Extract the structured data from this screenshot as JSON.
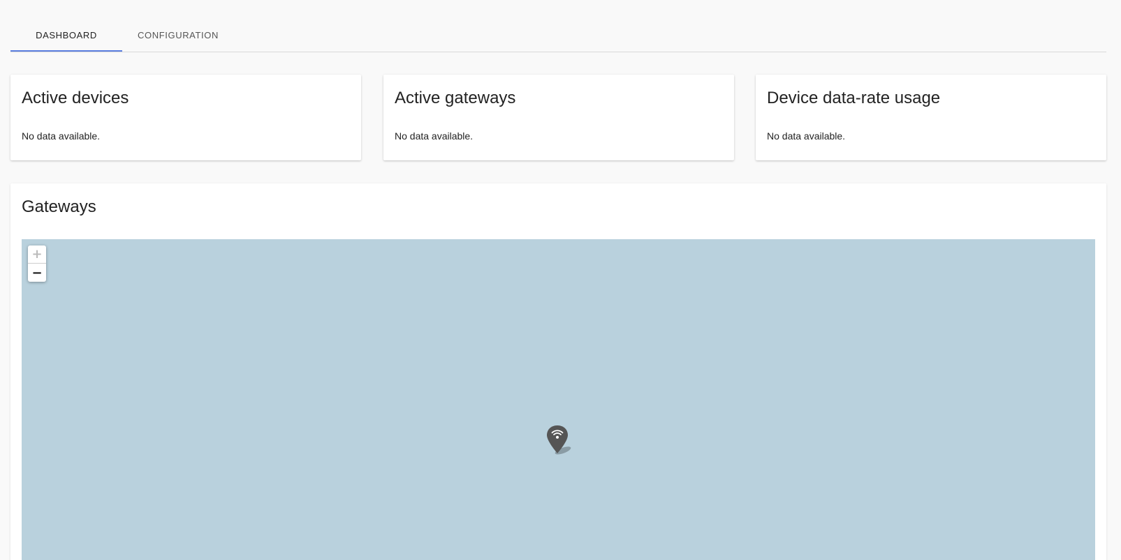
{
  "tabs": [
    {
      "label": "DASHBOARD",
      "active": true
    },
    {
      "label": "CONFIGURATION",
      "active": false
    }
  ],
  "stats": [
    {
      "title": "Active devices",
      "body": "No data available."
    },
    {
      "title": "Active gateways",
      "body": "No data available."
    },
    {
      "title": "Device data-rate usage",
      "body": "No data available."
    }
  ],
  "gateways": {
    "title": "Gateways",
    "map": {
      "zoom_in_label": "+",
      "zoom_out_label": "−",
      "zoom_in_enabled": false,
      "marker_icon": "wifi-pin-icon",
      "water_color": "#b9d1dd",
      "marker_color": "#555555"
    }
  },
  "colors": {
    "accent": "#5b7fe0",
    "background": "#f9f9f9",
    "card": "#ffffff"
  }
}
